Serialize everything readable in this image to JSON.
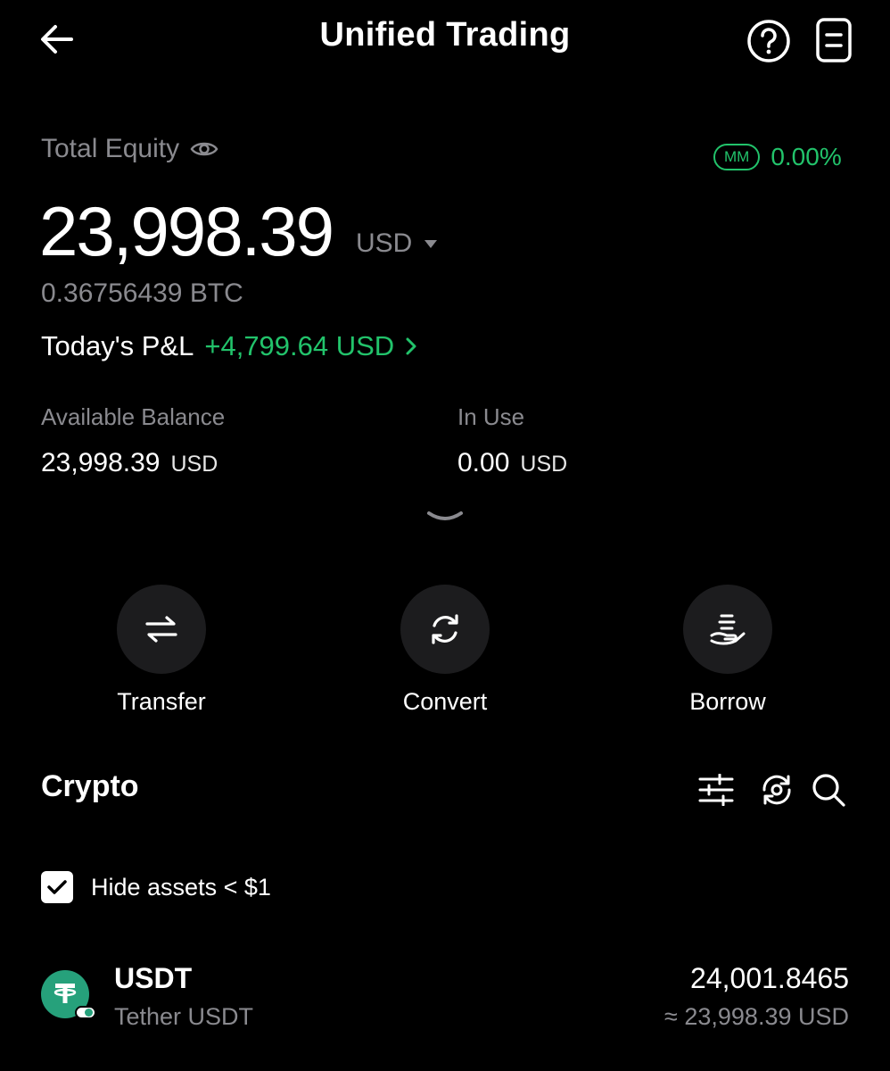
{
  "header": {
    "title": "Unified Trading",
    "back_icon": "arrow-left-icon",
    "help_icon": "question-circle-icon",
    "orders_icon": "document-icon"
  },
  "equity": {
    "label": "Total Equity",
    "mm_badge": "MM",
    "mm_value": "0.00%",
    "value": "23,998.39",
    "currency": "USD",
    "btc_value": "0.36756439 BTC",
    "pnl_label": "Today's P&L",
    "pnl_value": "+4,799.64 USD"
  },
  "balances": {
    "available_label": "Available Balance",
    "available_value": "23,998.39",
    "available_currency": "USD",
    "in_use_label": "In Use",
    "in_use_value": "0.00",
    "in_use_currency": "USD"
  },
  "actions": [
    {
      "label": "Transfer",
      "icon": "transfer-icon"
    },
    {
      "label": "Convert",
      "icon": "convert-icon"
    },
    {
      "label": "Borrow",
      "icon": "borrow-icon"
    }
  ],
  "crypto": {
    "title": "Crypto",
    "hide_small_label": "Hide assets < $1",
    "hide_small_checked": true,
    "assets": [
      {
        "symbol": "USDT",
        "name": "Tether USDT",
        "amount": "24,001.8465",
        "usd_value": "≈ 23,998.39 USD",
        "icon_color": "#26a17b"
      }
    ]
  },
  "colors": {
    "background": "#000000",
    "positive": "#22c36b",
    "muted": "#8a8a8f",
    "action_circle": "#1c1c1e"
  }
}
